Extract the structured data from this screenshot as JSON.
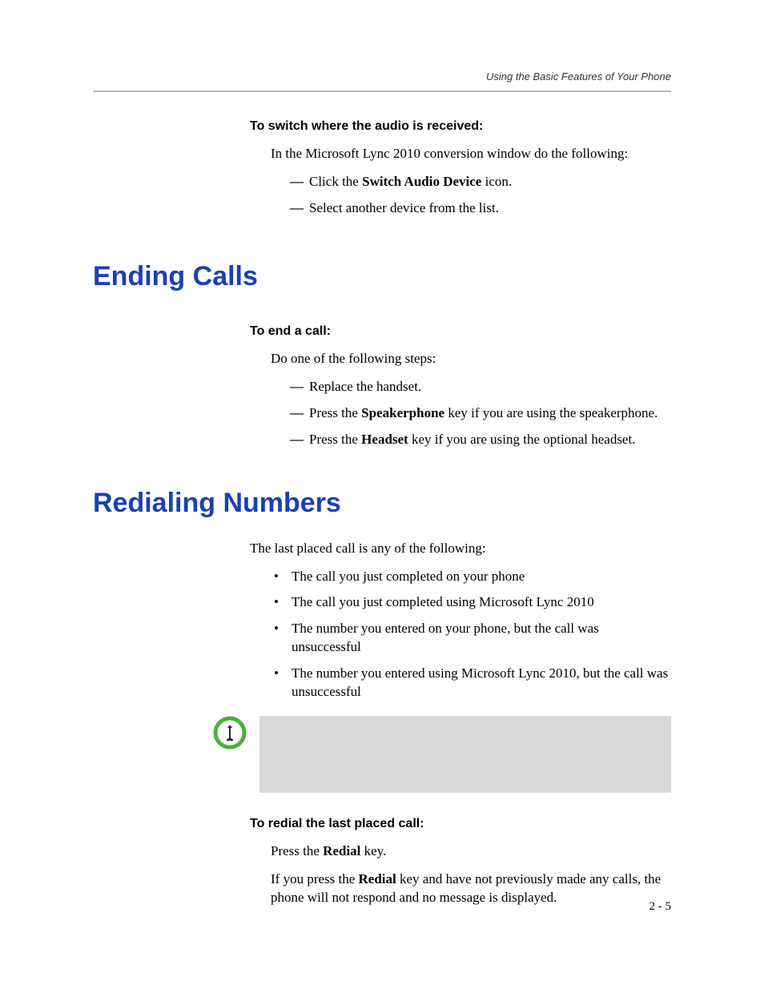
{
  "header": {
    "running_title": "Using the Basic Features of Your Phone"
  },
  "sec1": {
    "proc_title": "To switch where the audio is received:",
    "intro": "In the Microsoft Lync 2010 conversion window do the following:",
    "item1_pre": "Click the ",
    "item1_bold": "Switch Audio Device",
    "item1_post": " icon.",
    "item2": "Select another device from the list."
  },
  "sec2": {
    "heading": "Ending Calls",
    "proc_title": "To end a call:",
    "intro": "Do one of the following steps:",
    "item1": "Replace the handset.",
    "item2_pre": "Press the ",
    "item2_bold": "Speakerphone",
    "item2_post": " key if you are using the speakerphone.",
    "item3_pre": "Press the ",
    "item3_bold": "Headset",
    "item3_post": " key if you are using the optional headset."
  },
  "sec3": {
    "heading": "Redialing Numbers",
    "intro": "The last placed call is any of the following:",
    "b1": "The call you just completed on your phone",
    "b2": "The call you just completed using Microsoft Lync 2010",
    "b3": "The number you entered on your phone, but the call was unsuccessful",
    "b4": "The number you entered using Microsoft Lync 2010, but the call was unsuccessful",
    "proc_title": "To redial the last placed call:",
    "p1_pre": "Press the ",
    "p1_bold": "Redial",
    "p1_post": " key.",
    "p2_pre": "If you press the ",
    "p2_bold": "Redial",
    "p2_post": " key and have not previously made any calls, the phone will not respond and no message is displayed."
  },
  "footer": {
    "page": "2 - 5"
  },
  "icons": {
    "tip": "tip-icon"
  }
}
